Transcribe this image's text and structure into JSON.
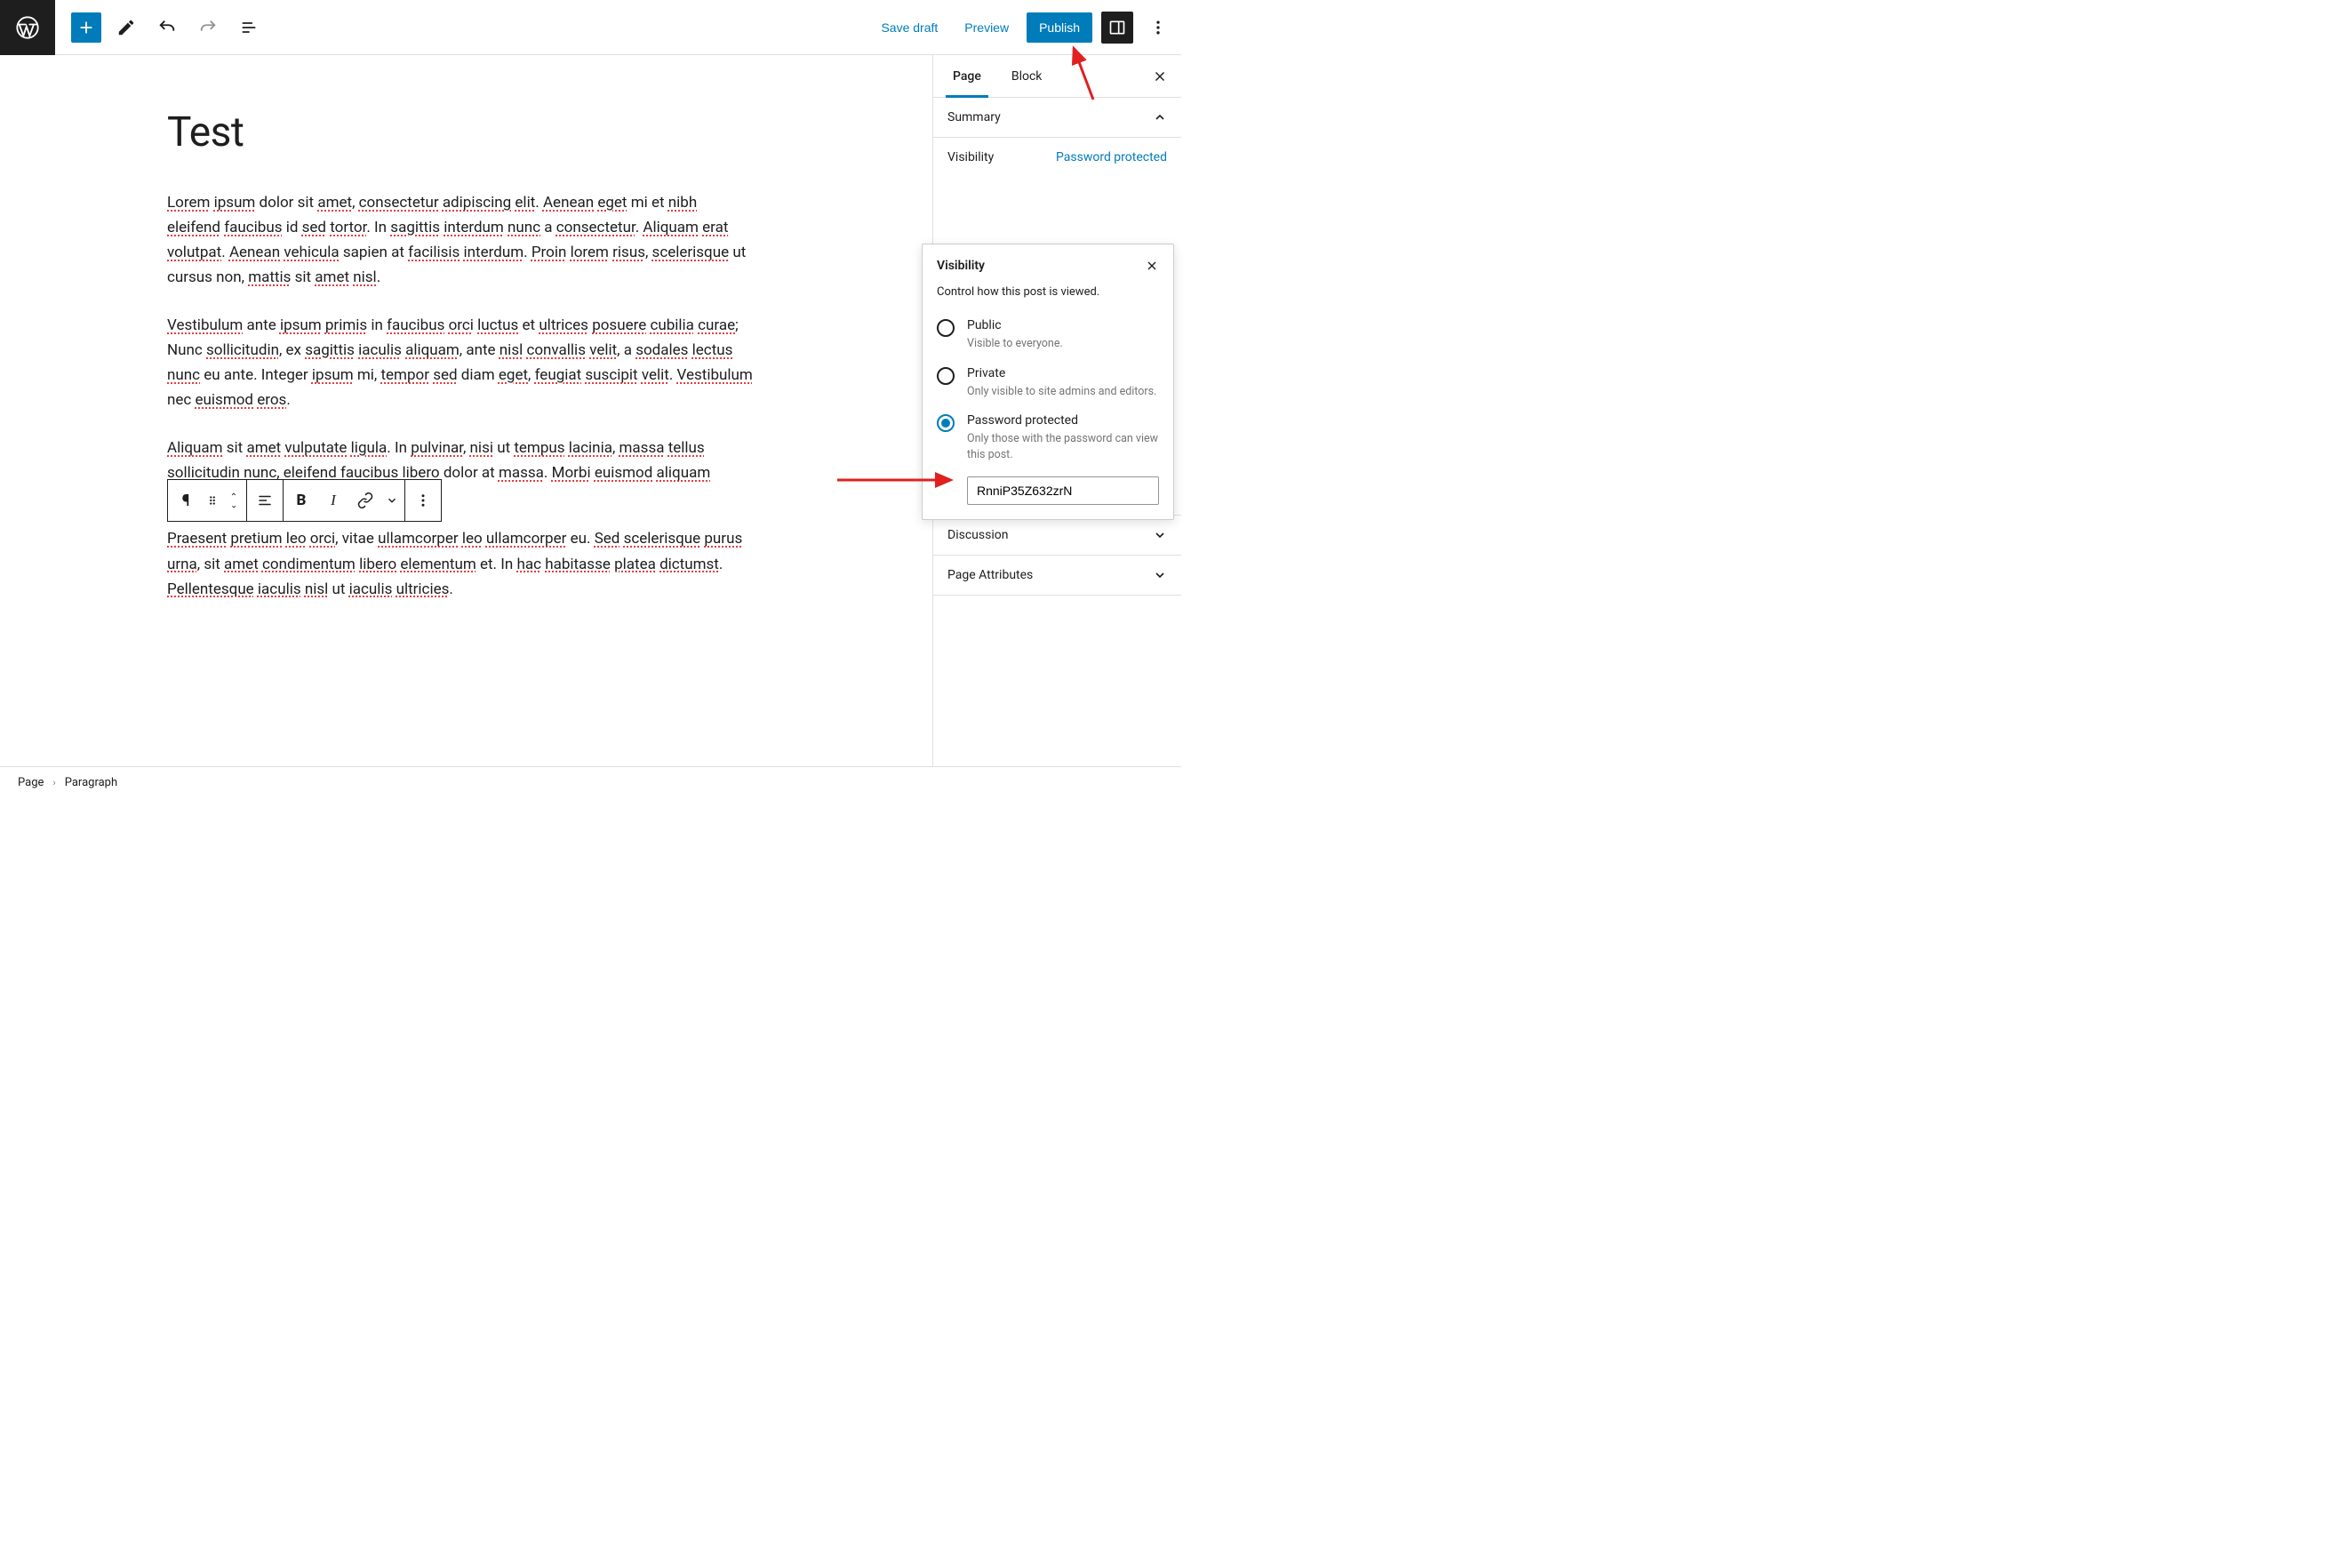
{
  "header": {
    "save_draft": "Save draft",
    "preview": "Preview",
    "publish": "Publish"
  },
  "editor": {
    "title": "Test",
    "paragraphs": [
      "Lorem ipsum dolor sit amet, consectetur adipiscing elit. Aenean eget mi et nibh eleifend faucibus id sed tortor. In sagittis interdum nunc a consectetur. Aliquam erat volutpat. Aenean vehicula sapien at facilisis interdum. Proin lorem risus, scelerisque ut cursus non, mattis sit amet nisl.",
      "Vestibulum ante ipsum primis in faucibus orci luctus et ultrices posuere cubilia curae; Nunc sollicitudin, ex sagittis iaculis aliquam, ante nisl convallis velit, a sodales lectus nunc eu ante. Integer ipsum mi, tempor sed diam eget, feugiat suscipit velit. Vestibulum nec euismod eros.",
      "Aliquam sit amet vulputate ligula. In pulvinar, nisi ut tempus lacinia, massa tellus sollicitudin nunc, eleifend faucibus libero dolor at massa. Morbi euismod aliquam",
      "Praesent pretium leo orci, vitae ullamcorper leo ullamcorper eu. Sed scelerisque purus urna, sit amet condimentum libero elementum et. In hac habitasse platea dictumst. Pellentesque iaculis nisl ut iaculis ultricies."
    ]
  },
  "sidebar": {
    "tabs": {
      "page": "Page",
      "block": "Block"
    },
    "summary": "Summary",
    "visibility_label": "Visibility",
    "visibility_value": "Password protected",
    "discussion": "Discussion",
    "page_attributes": "Page Attributes"
  },
  "visibility_popover": {
    "title": "Visibility",
    "description": "Control how this post is viewed.",
    "options": [
      {
        "label": "Public",
        "help": "Visible to everyone.",
        "checked": false
      },
      {
        "label": "Private",
        "help": "Only visible to site admins and editors.",
        "checked": false
      },
      {
        "label": "Password protected",
        "help": "Only those with the password can view this post.",
        "checked": true
      }
    ],
    "password_value": "RnniP35Z632zrN"
  },
  "breadcrumb": {
    "root": "Page",
    "current": "Paragraph"
  }
}
